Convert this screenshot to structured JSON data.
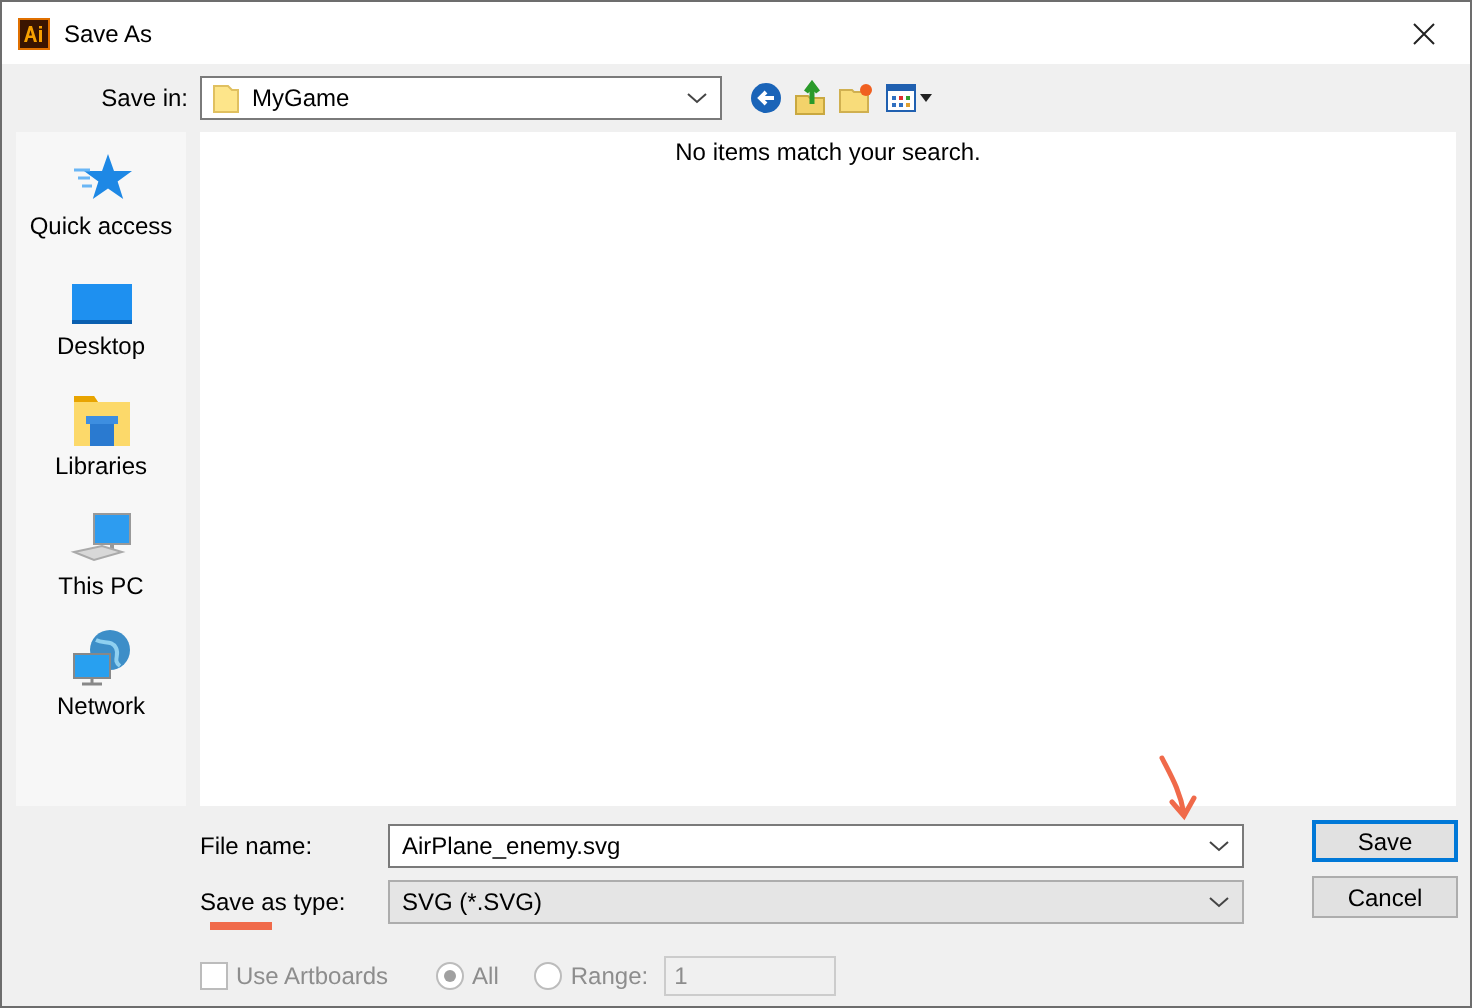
{
  "window": {
    "title": "Save As"
  },
  "save_in": {
    "label": "Save in:",
    "value": "MyGame"
  },
  "places": [
    {
      "label": "Quick access",
      "kind": "star"
    },
    {
      "label": "Desktop",
      "kind": "desktop"
    },
    {
      "label": "Libraries",
      "kind": "libraries"
    },
    {
      "label": "This PC",
      "kind": "pc"
    },
    {
      "label": "Network",
      "kind": "network"
    }
  ],
  "file_list": {
    "message": "No items match your search."
  },
  "file_name": {
    "label": "File name:",
    "value": "AirPlane_enemy.svg"
  },
  "save_as_type": {
    "label": "Save as type:",
    "value": "SVG (*.SVG)"
  },
  "buttons": [
    {
      "label": "Save",
      "default": true
    },
    {
      "label": "Cancel",
      "default": false
    }
  ],
  "options": {
    "use_artboards": {
      "label": "Use Artboards",
      "checked": false,
      "disabled": true
    },
    "ranges": [
      {
        "label": "All",
        "selected": true,
        "disabled": true
      },
      {
        "label": "Range:",
        "selected": false,
        "disabled": true
      }
    ],
    "range_value": {
      "value": "1",
      "disabled": true
    }
  }
}
